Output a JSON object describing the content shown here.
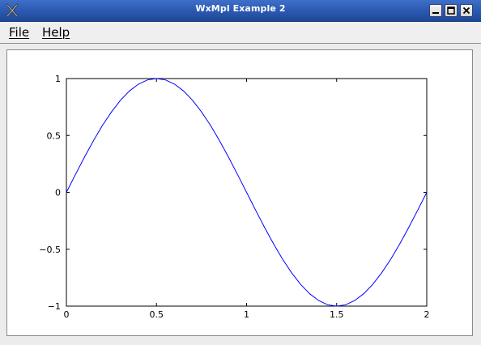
{
  "window": {
    "title": "WxMpl Example 2",
    "icon": "x-window-icon",
    "controls": [
      "minimize-icon",
      "maximize-icon",
      "close-icon"
    ]
  },
  "menubar": {
    "items": [
      {
        "label": "File"
      },
      {
        "label": "Help"
      }
    ]
  },
  "colors": {
    "titlebar": "#2a58b0",
    "line": "#0000ff",
    "axes": "#000000"
  },
  "chart_data": {
    "type": "line",
    "title": "",
    "xlabel": "",
    "ylabel": "",
    "xlim": [
      0,
      2
    ],
    "ylim": [
      -1,
      1
    ],
    "xticks": [
      0,
      0.5,
      1,
      1.5,
      2
    ],
    "xtick_labels": [
      "0",
      "0.5",
      "1",
      "1.5",
      "2"
    ],
    "yticks": [
      -1,
      -0.5,
      0,
      0.5,
      1
    ],
    "ytick_labels": [
      "−1",
      "−0.5",
      "0",
      "0.5",
      "1"
    ],
    "grid": false,
    "series": [
      {
        "color": "#0000ff",
        "x": [
          0,
          0.05,
          0.1,
          0.15,
          0.2,
          0.25,
          0.3,
          0.35,
          0.4,
          0.45,
          0.5,
          0.55,
          0.6,
          0.65,
          0.7,
          0.75,
          0.8,
          0.85,
          0.9,
          0.95,
          1.0,
          1.05,
          1.1,
          1.15,
          1.2,
          1.25,
          1.3,
          1.35,
          1.4,
          1.45,
          1.5,
          1.55,
          1.6,
          1.65,
          1.7,
          1.75,
          1.8,
          1.85,
          1.9,
          1.95,
          2.0
        ],
        "y": [
          0,
          0.156,
          0.309,
          0.454,
          0.588,
          0.707,
          0.809,
          0.891,
          0.951,
          0.988,
          1.0,
          0.988,
          0.951,
          0.891,
          0.809,
          0.707,
          0.588,
          0.454,
          0.309,
          0.156,
          0,
          -0.156,
          -0.309,
          -0.454,
          -0.588,
          -0.707,
          -0.809,
          -0.891,
          -0.951,
          -0.988,
          -1.0,
          -0.988,
          -0.951,
          -0.891,
          -0.809,
          -0.707,
          -0.588,
          -0.454,
          -0.309,
          -0.156,
          0
        ]
      }
    ]
  }
}
